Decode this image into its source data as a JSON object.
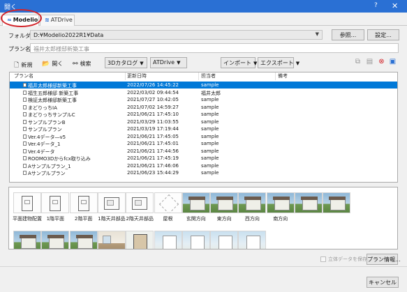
{
  "window": {
    "title": "開く",
    "help": "?",
    "close": "✕"
  },
  "tabs": [
    {
      "icon": "≈",
      "label": "Modelio"
    },
    {
      "icon": "≋",
      "label": "ATDrive"
    }
  ],
  "folder": {
    "label": "フォルダ",
    "value": "D:¥Modelio2022R1¥Data",
    "browse": "参照...",
    "settings": "設定..."
  },
  "plan_name": {
    "label": "プラン名",
    "value": "福井太郎様邸新築工事"
  },
  "toolbar": {
    "new": "新規",
    "open": "開く",
    "search": "検索",
    "catalog3d": "3Dカタログ",
    "atdrive": "ATDrive",
    "import": "インポート",
    "export": "エクスポート"
  },
  "columns": [
    "プラン名",
    "更新日時",
    "担当者",
    "備考"
  ],
  "rows": [
    {
      "name": "福井太郎様邸新築工事",
      "updated": "2022/07/26 14:45:22",
      "owner": "sample",
      "note": ""
    },
    {
      "name": "福生五郎様邸 新築工事",
      "updated": "2022/03/02 09:44:54",
      "owner": "福井太郎",
      "note": ""
    },
    {
      "name": "検証太郎様邸新築工事",
      "updated": "2021/07/27 10:42:05",
      "owner": "sample",
      "note": ""
    },
    {
      "name": "まどりっちIA",
      "updated": "2021/07/02 14:59:27",
      "owner": "sample",
      "note": ""
    },
    {
      "name": "まどりっちサンプルC",
      "updated": "2021/06/21 17:45:10",
      "owner": "sample",
      "note": ""
    },
    {
      "name": "サンプルプランB",
      "updated": "2021/03/29 11:03:55",
      "owner": "sample",
      "note": ""
    },
    {
      "name": "サンプルプラン",
      "updated": "2021/03/19 17:19:44",
      "owner": "sample",
      "note": ""
    },
    {
      "name": "Ver.4データ―v5",
      "updated": "2021/06/21 17:45:05",
      "owner": "sample",
      "note": ""
    },
    {
      "name": "Ver.4データ_1",
      "updated": "2021/06/21 17:45:01",
      "owner": "sample",
      "note": ""
    },
    {
      "name": "Ver.4データ",
      "updated": "2021/06/21 17:44:56",
      "owner": "sample",
      "note": ""
    },
    {
      "name": "ROOMO3Dからfcx取り込み",
      "updated": "2021/06/21 17:45:19",
      "owner": "sample",
      "note": ""
    },
    {
      "name": "Aサンプルプラン_1",
      "updated": "2021/06/21 17:46:06",
      "owner": "sample",
      "note": ""
    },
    {
      "name": "Aサンプルプラン",
      "updated": "2021/06/23 15:44:29",
      "owner": "sample",
      "note": ""
    }
  ],
  "thumbnails": [
    {
      "label": "平面建物配置",
      "kind": "plan"
    },
    {
      "label": "1階平面",
      "kind": "plan"
    },
    {
      "label": "2階平面",
      "kind": "plan"
    },
    {
      "label": "1階天井部品",
      "kind": "plan2"
    },
    {
      "label": "2階天井部品",
      "kind": "plan2"
    },
    {
      "label": "屋根",
      "kind": "roof"
    },
    {
      "label": "玄関方向",
      "kind": "house"
    },
    {
      "label": "東方向",
      "kind": "house"
    },
    {
      "label": "西方向",
      "kind": "house"
    },
    {
      "label": "南方向",
      "kind": "house"
    },
    {
      "label": "",
      "kind": "house"
    },
    {
      "label": "",
      "kind": "house"
    },
    {
      "label": "",
      "kind": "house"
    },
    {
      "label": "",
      "kind": "house"
    },
    {
      "label": "",
      "kind": "house"
    },
    {
      "label": "",
      "kind": "interior"
    },
    {
      "label": "",
      "kind": "plancolor"
    },
    {
      "label": "",
      "kind": "sky"
    },
    {
      "label": "",
      "kind": "sky"
    },
    {
      "label": "",
      "kind": "sky"
    },
    {
      "label": "",
      "kind": "sky"
    }
  ],
  "footer": {
    "save3d": "立体データを保存",
    "plan_info": "プラン情報...",
    "cancel": "キャンセル"
  }
}
